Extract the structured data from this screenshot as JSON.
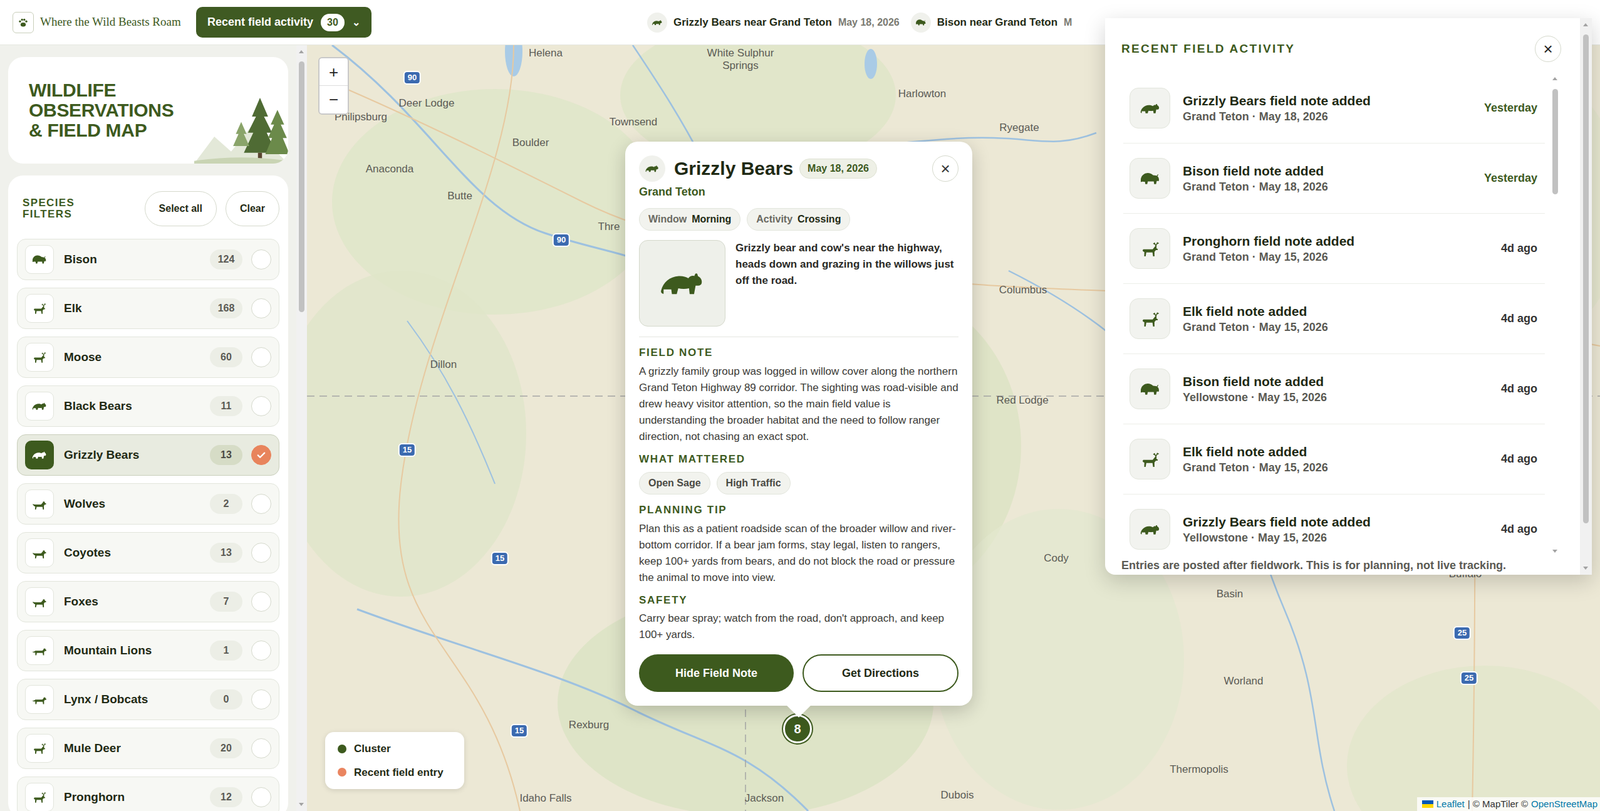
{
  "logo": {
    "text": "Where the Wild Beasts Roam"
  },
  "topbar": {
    "activity_button": {
      "label": "Recent field activity",
      "count": "30",
      "caret": "⌄"
    },
    "ticker": [
      {
        "label": "Grizzly Bears near Grand Teton",
        "date": "May 18, 2026"
      },
      {
        "label": "Bison near Grand Teton",
        "date": "M"
      }
    ]
  },
  "sidebar": {
    "title_lines": [
      "WILDLIFE",
      "OBSERVATIONS",
      "& FIELD MAP"
    ],
    "filters_heading": [
      "SPECIES",
      "FILTERS"
    ],
    "select_all": "Select all",
    "clear": "Clear",
    "items": [
      {
        "name": "Bison",
        "count": "124",
        "checked": false
      },
      {
        "name": "Elk",
        "count": "168",
        "checked": false
      },
      {
        "name": "Moose",
        "count": "60",
        "checked": false
      },
      {
        "name": "Black Bears",
        "count": "11",
        "checked": false
      },
      {
        "name": "Grizzly Bears",
        "count": "13",
        "checked": true
      },
      {
        "name": "Wolves",
        "count": "2",
        "checked": false
      },
      {
        "name": "Coyotes",
        "count": "13",
        "checked": false
      },
      {
        "name": "Foxes",
        "count": "7",
        "checked": false
      },
      {
        "name": "Mountain Lions",
        "count": "1",
        "checked": false
      },
      {
        "name": "Lynx / Bobcats",
        "count": "0",
        "checked": false
      },
      {
        "name": "Mule Deer",
        "count": "20",
        "checked": false
      },
      {
        "name": "Pronghorn",
        "count": "12",
        "checked": false
      }
    ]
  },
  "map": {
    "zoom": [
      "+",
      "−"
    ],
    "labels": [
      "Helena",
      "White Sulphur Springs",
      "Harlowton",
      "Ryegate",
      "Deer Lodge",
      "Townsend",
      "Philipsburg",
      "Boulder",
      "Anaconda",
      "Butte",
      "Thre",
      "Dillon",
      "Columbus",
      "Red Lodge",
      "Cody",
      "Basin",
      "Buffalo",
      "Worland",
      "Thermopolis",
      "Rexburg",
      "Idaho Falls",
      "Jackson",
      "Dubois"
    ],
    "shields": [
      "90",
      "90",
      "15",
      "15",
      "15",
      "25",
      "25"
    ],
    "cluster": {
      "count": "8"
    },
    "legend": [
      {
        "label": "Cluster",
        "color": "#3d5a1e"
      },
      {
        "label": "Recent field entry",
        "color": "#ea8560"
      }
    ],
    "attribution": {
      "leaflet": "Leaflet",
      "middle": "| © MapTiler ©",
      "osm": "OpenStreetMap"
    }
  },
  "popup": {
    "title": "Grizzly Bears",
    "date": "May 18, 2026",
    "place": "Grand Teton",
    "close": "×",
    "chips": [
      {
        "label": "Window",
        "value": "Morning"
      },
      {
        "label": "Activity",
        "value": "Crossing"
      }
    ],
    "summary": "Grizzly bear and cow's near the highway, heads down and grazing in the willows just off the road.",
    "field_note": {
      "heading": "FIELD NOTE",
      "text": "A grizzly family group was logged in willow cover along the northern Grand Teton Highway 89 corridor. The sighting was road-visible and drew heavy visitor attention, so the main field value is understanding the broader habitat and the need to follow ranger direction, not chasing an exact spot."
    },
    "what_mattered": {
      "heading": "WHAT MATTERED",
      "tags": [
        "Open Sage",
        "High Traffic"
      ]
    },
    "planning_tip": {
      "heading": "PLANNING TIP",
      "text": "Plan this as a patient roadside scan of the broader willow and river-bottom corridor. If a bear jam forms, stay legal, listen to rangers, keep 100+ yards from bears, and do not block the road or pressure the animal to move into view."
    },
    "safety": {
      "heading": "SAFETY",
      "text": "Carry bear spray; watch from the road, don't approach, and keep 100+ yards."
    },
    "buttons": {
      "primary": "Hide Field Note",
      "secondary": "Get Directions"
    }
  },
  "activity_panel": {
    "title": "RECENT FIELD ACTIVITY",
    "close": "×",
    "entries": [
      {
        "title": "Grizzly Bears field note added",
        "place": "Grand Teton · May 18, 2026",
        "when": "Yesterday",
        "recent": true
      },
      {
        "title": "Bison field note added",
        "place": "Grand Teton · May 18, 2026",
        "when": "Yesterday",
        "recent": true
      },
      {
        "title": "Pronghorn field note added",
        "place": "Grand Teton · May 15, 2026",
        "when": "4d ago",
        "recent": false
      },
      {
        "title": "Elk field note added",
        "place": "Grand Teton · May 15, 2026",
        "when": "4d ago",
        "recent": false
      },
      {
        "title": "Bison field note added",
        "place": "Yellowstone · May 15, 2026",
        "when": "4d ago",
        "recent": false
      },
      {
        "title": "Elk field note added",
        "place": "Grand Teton · May 15, 2026",
        "when": "4d ago",
        "recent": false
      },
      {
        "title": "Grizzly Bears field note added",
        "place": "Yellowstone · May 15, 2026",
        "when": "4d ago",
        "recent": false
      }
    ],
    "footer": "Entries are posted after fieldwork. This is for planning, not live tracking."
  }
}
